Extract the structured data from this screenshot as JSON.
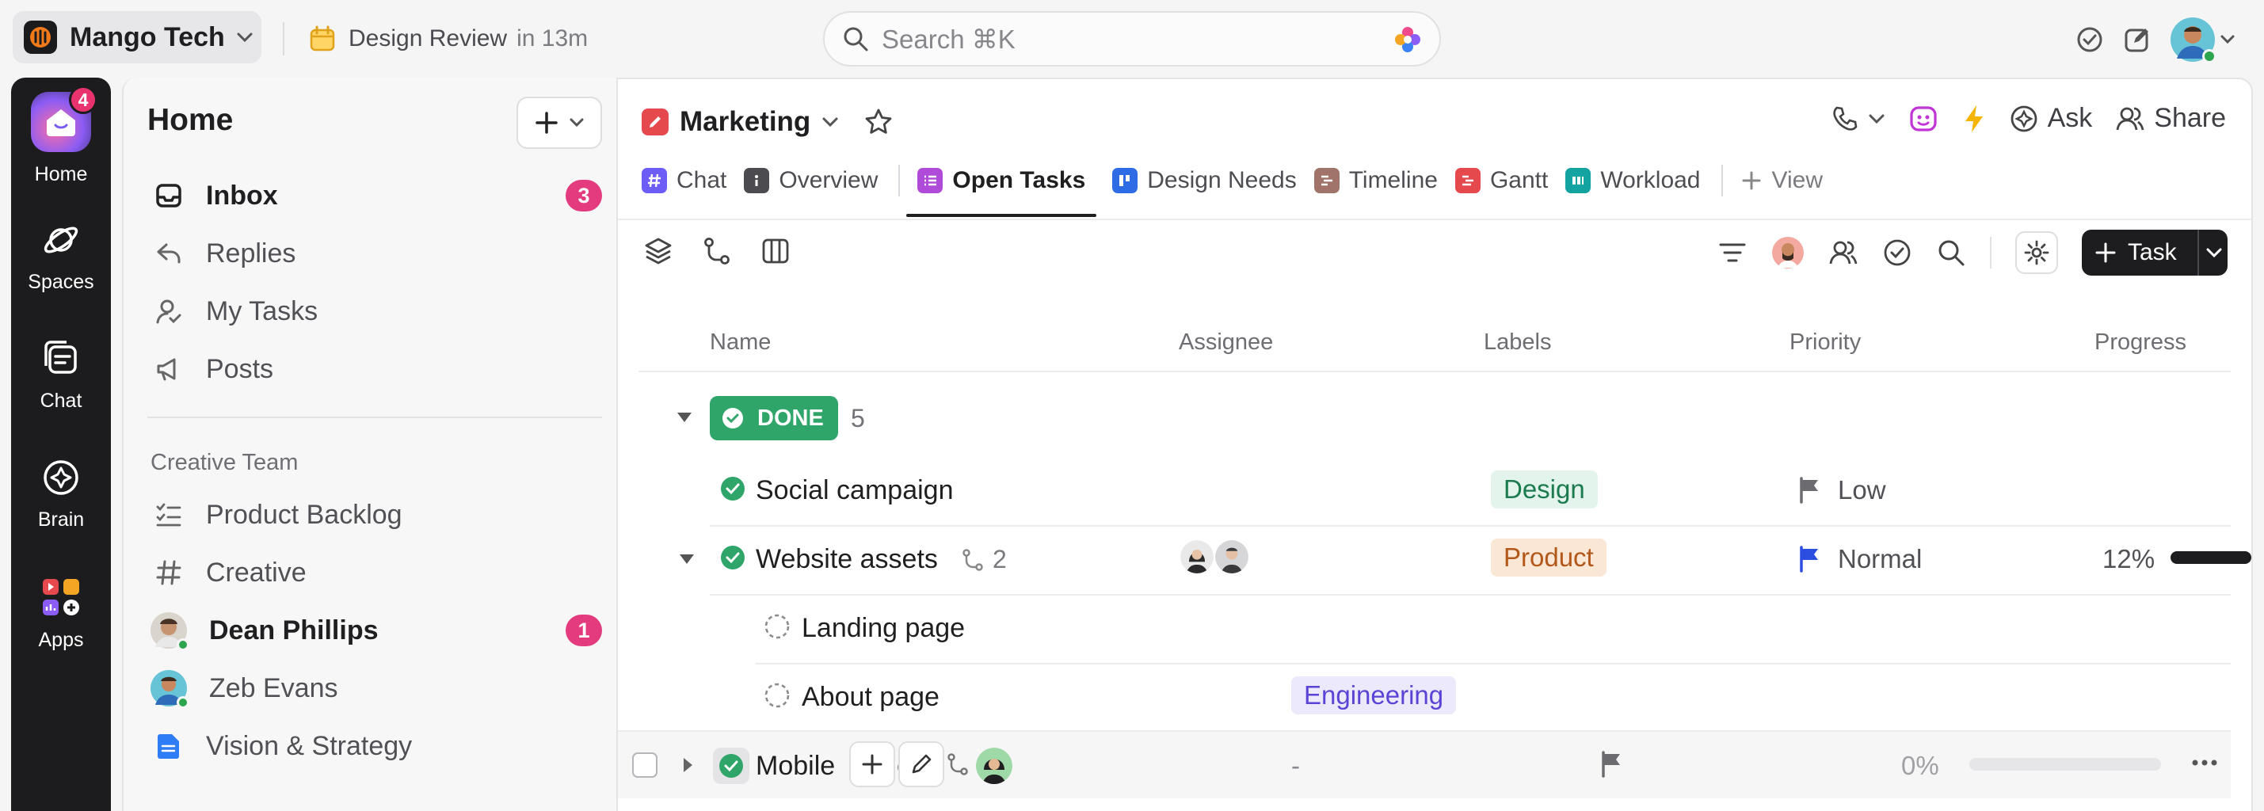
{
  "workspace": {
    "name": "Mango Tech"
  },
  "meeting": {
    "title": "Design Review",
    "time": "in 13m"
  },
  "search": {
    "placeholder": "Search ⌘K"
  },
  "rail": {
    "home": {
      "label": "Home",
      "badge": "4"
    },
    "spaces": {
      "label": "Spaces"
    },
    "chat": {
      "label": "Chat"
    },
    "brain": {
      "label": "Brain"
    },
    "apps": {
      "label": "Apps"
    }
  },
  "sidebar": {
    "title": "Home",
    "items": [
      {
        "label": "Inbox",
        "badge": "3"
      },
      {
        "label": "Replies"
      },
      {
        "label": "My Tasks"
      },
      {
        "label": "Posts"
      }
    ],
    "section_title": "Creative Team",
    "team_items": [
      {
        "label": "Product Backlog"
      },
      {
        "label": "Creative"
      },
      {
        "label": "Dean Phillips",
        "badge": "1"
      },
      {
        "label": "Zeb Evans"
      },
      {
        "label": "Vision & Strategy"
      }
    ]
  },
  "header": {
    "space_name": "Marketing",
    "ask_label": "Ask",
    "share_label": "Share"
  },
  "tabs": [
    {
      "label": "Chat",
      "color": "#6d5cf6"
    },
    {
      "label": "Overview",
      "color": "#4b4b50"
    },
    {
      "label": "Open Tasks",
      "color": "#b04ad8",
      "active": true
    },
    {
      "label": "Design Needs",
      "color": "#2e6ce6"
    },
    {
      "label": "Timeline",
      "color": "#a0746b"
    },
    {
      "label": "Gantt",
      "color": "#e5484d"
    },
    {
      "label": "Workload",
      "color": "#13a3a0"
    }
  ],
  "add_view_label": "View",
  "toolbar": {
    "task_label": "Task"
  },
  "columns": {
    "name": "Name",
    "assignee": "Assignee",
    "labels": "Labels",
    "priority": "Priority",
    "progress": "Progress"
  },
  "group": {
    "status": "DONE",
    "count": "5",
    "color": "#2fa56a"
  },
  "tasks": [
    {
      "name": "Social campaign",
      "label": "Design",
      "priority": "Low"
    },
    {
      "name": "Website assets",
      "subtasks": "2",
      "label": "Product",
      "priority": "Normal",
      "progress_text": "12%",
      "progress": 0.12
    },
    {
      "name": "Landing page"
    },
    {
      "name": "About page",
      "label": "Engineering"
    },
    {
      "name": "Mobile",
      "name_tail": "e",
      "assignee": "-",
      "progress_text": "0%",
      "progress": 0
    }
  ]
}
